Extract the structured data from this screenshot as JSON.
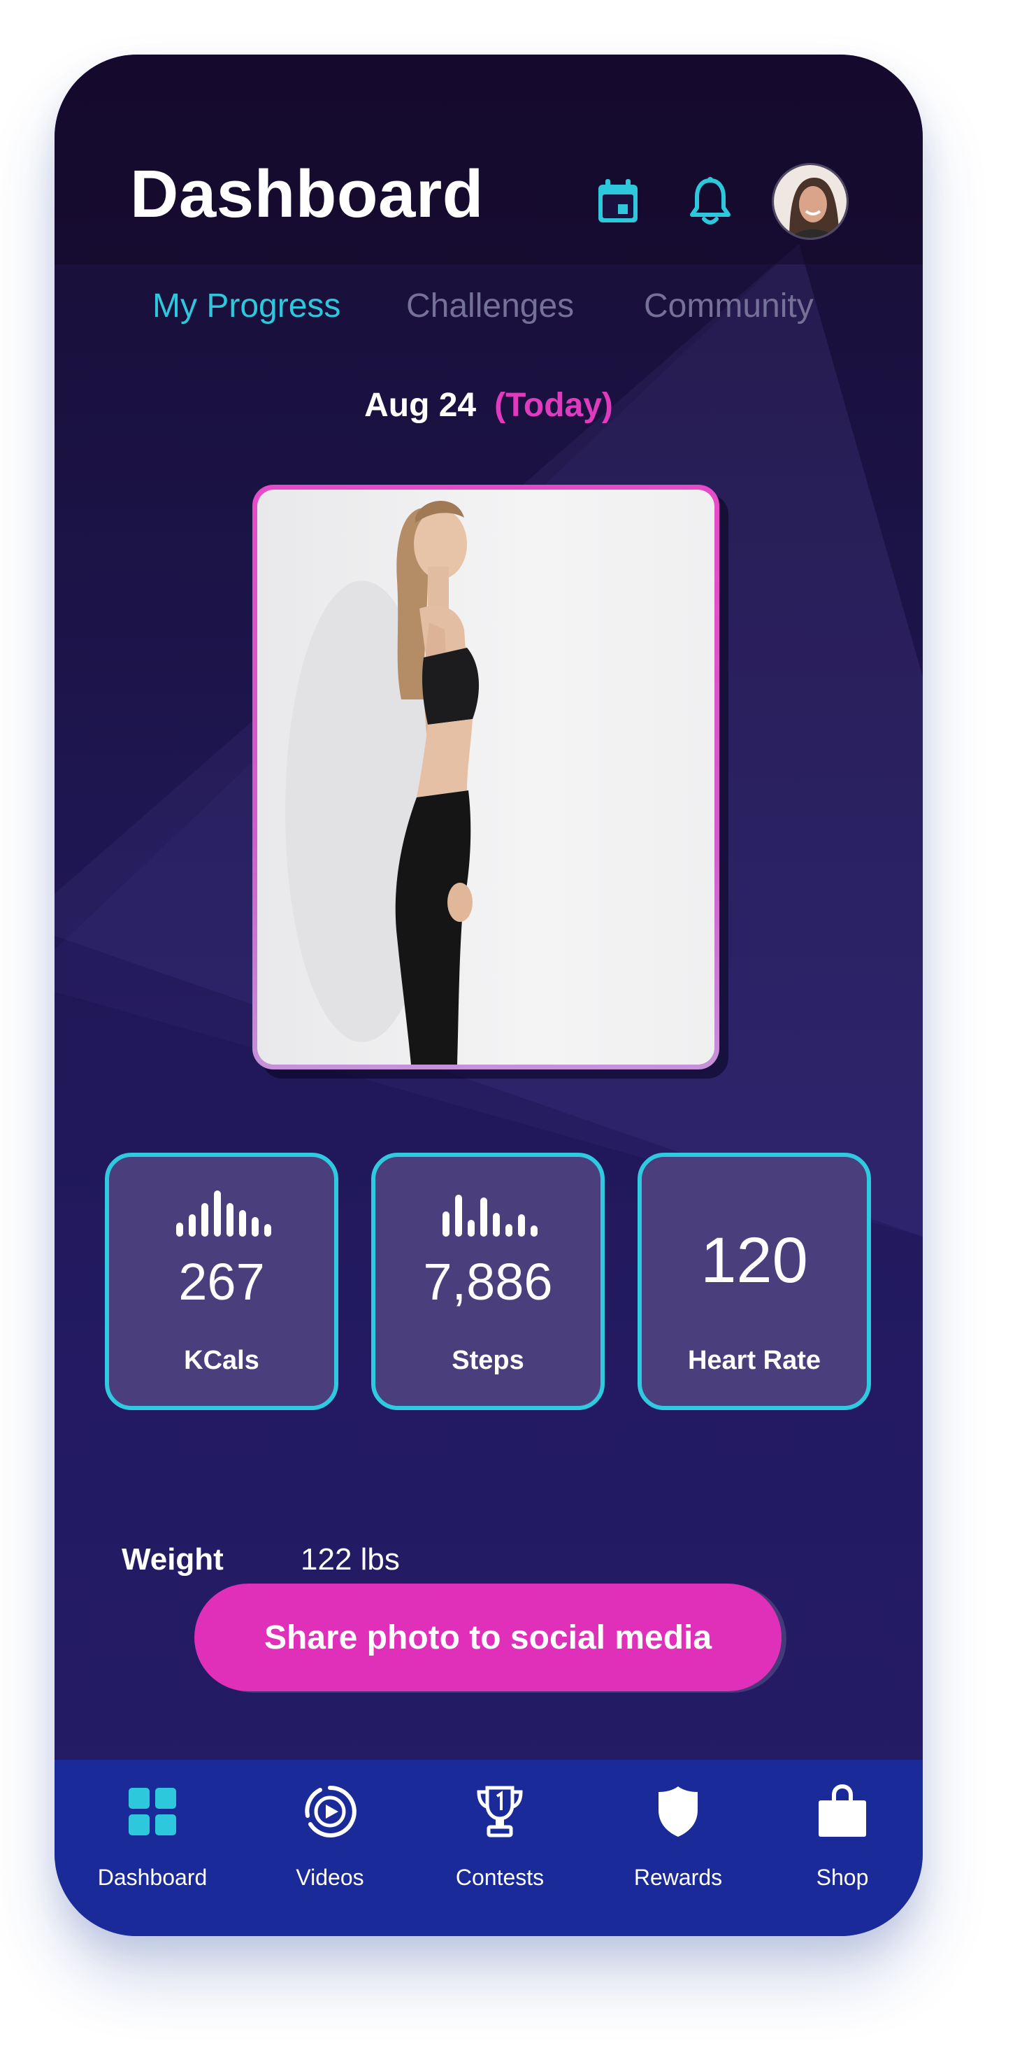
{
  "header": {
    "title": "Dashboard",
    "calendar_icon": "calendar-icon",
    "bell_icon": "bell-icon",
    "avatar_icon": "user-avatar"
  },
  "tabs": [
    {
      "label": "My Progress",
      "active": true
    },
    {
      "label": "Challenges",
      "active": false
    },
    {
      "label": "Community",
      "active": false
    }
  ],
  "date": {
    "day": "Aug 24",
    "today": "(Today)"
  },
  "stats": [
    {
      "value": "267",
      "label": "KCals",
      "icon": "bar-levels-icon"
    },
    {
      "value": "7,886",
      "label": "Steps",
      "icon": "bar-levels-icon"
    },
    {
      "value": "120",
      "label": "Heart Rate"
    }
  ],
  "weight": {
    "label": "Weight",
    "value": "122 lbs"
  },
  "share_button": {
    "label": "Share photo to social media"
  },
  "bottom_nav": [
    {
      "label": "Dashboard",
      "icon": "grid-icon",
      "active": true
    },
    {
      "label": "Videos",
      "icon": "play-circle-icon",
      "active": false
    },
    {
      "label": "Contests",
      "icon": "trophy-icon",
      "active": false
    },
    {
      "label": "Rewards",
      "icon": "shield-icon",
      "active": false
    },
    {
      "label": "Shop",
      "icon": "shopping-bag-icon",
      "active": false
    }
  ],
  "colors": {
    "accent_cyan": "#2ec8dc",
    "accent_magenta": "#e02fb8",
    "background_dark": "#1e1650",
    "nav_blue": "#1a2b99",
    "card_fill": "#4a3f7c"
  }
}
